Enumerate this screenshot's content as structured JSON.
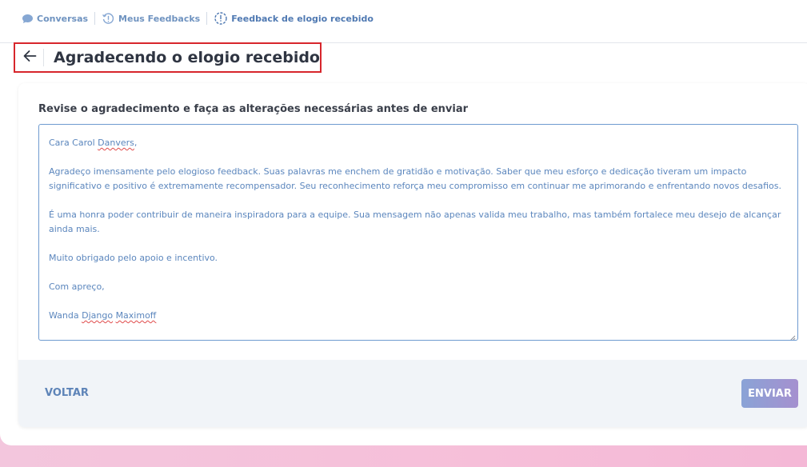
{
  "breadcrumb": {
    "items": [
      {
        "label": "Conversas",
        "icon": "chat-bubble-icon"
      },
      {
        "label": "Meus Feedbacks",
        "icon": "history-alert-icon"
      },
      {
        "label": "Feedback de elogio recebido",
        "icon": "alert-badge-icon"
      }
    ]
  },
  "header": {
    "back_icon": "arrow-left-icon",
    "title": "Agradecendo o elogio recebido"
  },
  "form": {
    "instruction": "Revise o agradecimento e faça as alterações necessárias antes de enviar",
    "message": {
      "greeting_prefix": "Cara Carol ",
      "greeting_name": "Danvers",
      "greeting_suffix": ",",
      "paragraph1": "Agradeço imensamente pelo elogioso feedback. Suas palavras me enchem de gratidão e motivação. Saber que meu esforço e dedicação tiveram um impacto significativo e positivo é extremamente recompensador. Seu reconhecimento reforça meu compromisso em continuar me aprimorando e enfrentando novos desafios.",
      "paragraph2": "É uma honra poder contribuir de maneira inspiradora para a equipe. Sua mensagem não apenas valida meu trabalho, mas também fortalece meu desejo de alcançar ainda mais.",
      "paragraph3": "Muito obrigado pelo apoio e incentivo.",
      "closing": "Com apreço,",
      "signature_first": "Wanda ",
      "signature_middle": "Django",
      "signature_space": " ",
      "signature_last": "Maximoff"
    }
  },
  "footer": {
    "back_label": "VOLTAR",
    "send_label": "ENVIAR"
  },
  "colors": {
    "accent": "#5e84b8",
    "highlight_border": "#d7262c",
    "text_blue": "#5b86bd"
  }
}
